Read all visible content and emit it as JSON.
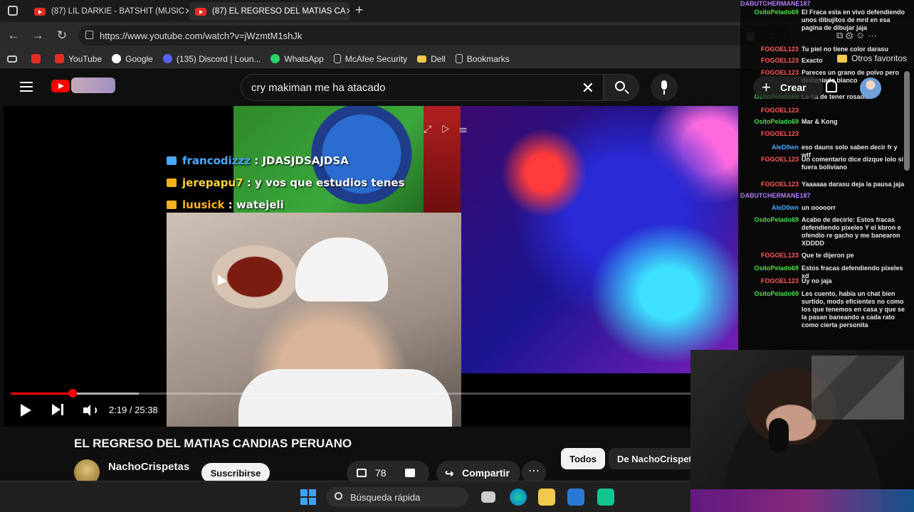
{
  "browser": {
    "tabs": [
      {
        "title": "(87) LIL DARKIE - BATSHIT (MUSIC",
        "active": false
      },
      {
        "title": "(87) EL REGRESO DEL MATIAS CA",
        "active": true
      }
    ],
    "new_tab": "+",
    "url": "https://www.youtube.com/watch?v=jWzmtM1shJk",
    "bookmarks": [
      {
        "label": "YouTube",
        "color": "#e52d27"
      },
      {
        "label": "Google",
        "color": "#4285f4"
      },
      {
        "label": "(135) Discord | Loun...",
        "color": "#5865f2"
      },
      {
        "label": "WhatsApp",
        "color": "#25d366"
      },
      {
        "label": "McAfee Security",
        "color": "#cfcfcf"
      },
      {
        "label": "Dell",
        "color": "#f2c94c"
      },
      {
        "label": "Bookmarks",
        "color": "#cfcfcf"
      }
    ],
    "other_favorites": "Otros favoritos"
  },
  "youtube": {
    "search_query": "cry makiman me ha atacado",
    "create_label": "Crear"
  },
  "video": {
    "overlay_chat": [
      {
        "user": "francodizzz",
        "message": "JDASJDSAJDSA",
        "user_color": "#4aa8ff"
      },
      {
        "user": "jerepapu7",
        "message": "y vos que estudios tenes",
        "user_color": "#ffd23d"
      },
      {
        "user": "luusick",
        "message": "watejeli",
        "user_color": "#ffb21d"
      }
    ],
    "current_time": "2:19",
    "duration": "25:38",
    "timecode": "2:19 / 25:38",
    "progress_fraction": 0.0904,
    "title": "EL REGRESO DEL MATIAS CANDIAS PERUANO",
    "channel": "NachoCrispetas",
    "subscribe_label": "Suscribirse",
    "likes": "78",
    "share_label": "Compartir",
    "more_label": "⋯",
    "chips": [
      "Todos",
      "De NachoCrispetas"
    ]
  },
  "side_chat": [
    {
      "name": "DABUTCHERMANE187",
      "text": "",
      "color": "#b37bff"
    },
    {
      "name": "OsitoPelado69",
      "text": "El Fraca esta en vivo defendiendo unos dibujitos de mrd en esa pagina de dibujar jaja",
      "color": "#4ce04c"
    },
    {
      "name": "FOGOEL123",
      "text": "Tu piel no tiene color darasu",
      "color": "#ff5a5a"
    },
    {
      "name": "FOGOEL123",
      "text": "Exacto",
      "color": "#ff5a5a"
    },
    {
      "name": "FOGOEL123",
      "text": "Pareces un grano de polvo pero demasiado blanco",
      "color": "#ff5a5a"
    },
    {
      "name": "OsitoPelado69",
      "text": "La ha de tener rosadita",
      "color": "#4ce04c"
    },
    {
      "name": "FOGOEL123",
      "text": "",
      "color": "#ff5a5a"
    },
    {
      "name": "OsitoPelado69",
      "text": "Mar & Kong",
      "color": "#4ce04c"
    },
    {
      "name": "FOGOEL123",
      "text": "",
      "color": "#ff5a5a"
    },
    {
      "name": "AleD0wn",
      "text": "eso dauns solo saben decir fr y wtf",
      "color": "#4aa8ff"
    },
    {
      "name": "FOGOEL123",
      "text": "Un comentario dice dizque lolo si fuera boliviano",
      "color": "#ff5a5a"
    },
    {
      "name": "FOGOEL123",
      "text": "Yaaaaaa darasu deja la pausa jaja",
      "color": "#ff5a5a"
    },
    {
      "name": "DABUTCHERMANE187",
      "text": "",
      "color": "#b37bff"
    },
    {
      "name": "AleD0wn",
      "text": "un ooooorr",
      "color": "#4aa8ff"
    },
    {
      "name": "OsitoPelado69",
      "text": "Acabo de decirle: Estos fracas defendiendo pixeles Y el kbron e ofendio re gacho y me banearon XDDDD",
      "color": "#4ce04c"
    },
    {
      "name": "FOGOEL123",
      "text": "Que te dijeron pe",
      "color": "#ff5a5a"
    },
    {
      "name": "OsitoPelado69",
      "text": "Estos fracas defendiendo pixeles xd",
      "color": "#4ce04c"
    },
    {
      "name": "FOGOEL123",
      "text": "Uy no jaja",
      "color": "#ff5a5a"
    },
    {
      "name": "OsitoPelado69",
      "text": "Les cuento, habia un chat bien surtido, mods eficientes no como los que tenemos en casa y que se la pasan baneando a cada rato como cierta personita",
      "color": "#4ce04c"
    }
  ],
  "taskbar": {
    "search_placeholder": "Búsqueda rápida"
  }
}
